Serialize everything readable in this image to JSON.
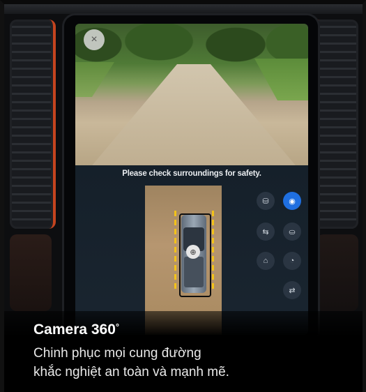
{
  "camera": {
    "safety_message": "Please check surroundings for safety.",
    "close_icon": "×",
    "zoom_icon": "⊕",
    "controls": [
      {
        "name": "rear-view",
        "icon": "⛁",
        "active": false
      },
      {
        "name": "surround-view",
        "icon": "◉",
        "active": true
      },
      {
        "name": "side-view",
        "icon": "⇆",
        "active": false
      },
      {
        "name": "front-view",
        "icon": "⛀",
        "active": false
      },
      {
        "name": "top-view",
        "icon": "⌂",
        "active": false
      },
      {
        "name": "wheel-view",
        "icon": "◔",
        "active": false
      },
      {
        "name": "settings",
        "icon": "⇄",
        "active": false
      }
    ]
  },
  "caption": {
    "title": "Camera 360",
    "title_sup": "°",
    "line1": "Chinh phục mọi cung đường",
    "line2": "khắc nghiệt an toàn và mạnh mẽ."
  }
}
